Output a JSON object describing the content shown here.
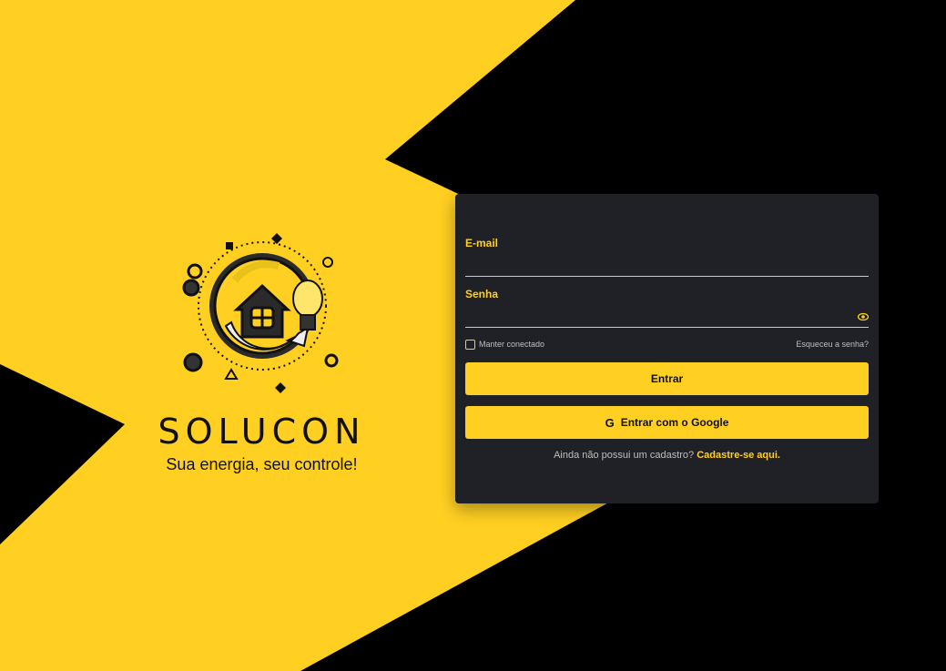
{
  "colors": {
    "accent": "#FFCF22",
    "card_bg": "#202126",
    "background_dark": "#000000"
  },
  "brand": {
    "name": "SOLUCON",
    "tagline": "Sua energia, seu controle!",
    "logo_icon": "house-lightbulb-logo"
  },
  "login": {
    "email_label": "E-mail",
    "email_value": "",
    "password_label": "Senha",
    "password_value": "",
    "show_password_icon": "eye-icon",
    "remember_label": "Manter conectado",
    "remember_checked": false,
    "forgot_link": "Esqueceu a senha?",
    "submit_label": "Entrar",
    "google_icon": "google-icon",
    "google_label": "Entrar com o Google",
    "signup_prompt": "Ainda não possui um cadastro?",
    "signup_link": "Cadastre-se aqui."
  }
}
